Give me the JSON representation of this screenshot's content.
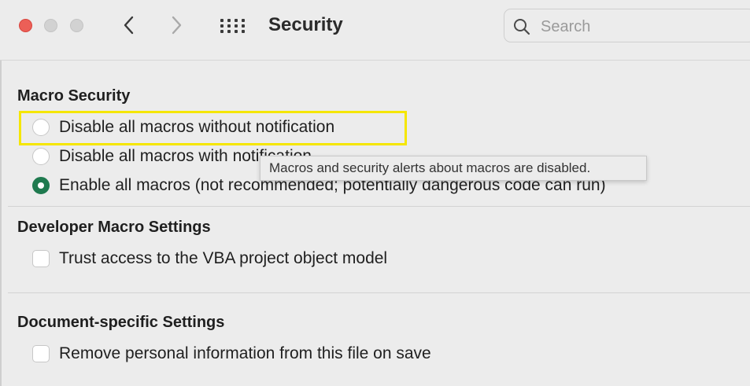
{
  "window": {
    "title": "Security",
    "search_placeholder": "Search"
  },
  "macro_security": {
    "heading": "Macro Security",
    "options": [
      {
        "label": "Disable all macros without notification",
        "selected": false
      },
      {
        "label": "Disable all macros with notification",
        "selected": false
      },
      {
        "label": "Enable all macros (not recommended; potentially dangerous code can run)",
        "selected": true
      }
    ],
    "tooltip": "Macros and security alerts about macros are disabled."
  },
  "developer_macro_settings": {
    "heading": "Developer Macro Settings",
    "trust_vba_label": "Trust access to the VBA project object model",
    "trust_vba_checked": false
  },
  "document_specific_settings": {
    "heading": "Document-specific Settings",
    "remove_personal_info_label": "Remove personal information from this file on save",
    "remove_personal_info_checked": false
  },
  "colors": {
    "close_light": "#ec5f57",
    "selected_radio": "#1f7a4f",
    "highlight_box": "#f5e600"
  },
  "icons": [
    "back-chevron-icon",
    "forward-chevron-icon",
    "grid-icon",
    "search-icon"
  ]
}
